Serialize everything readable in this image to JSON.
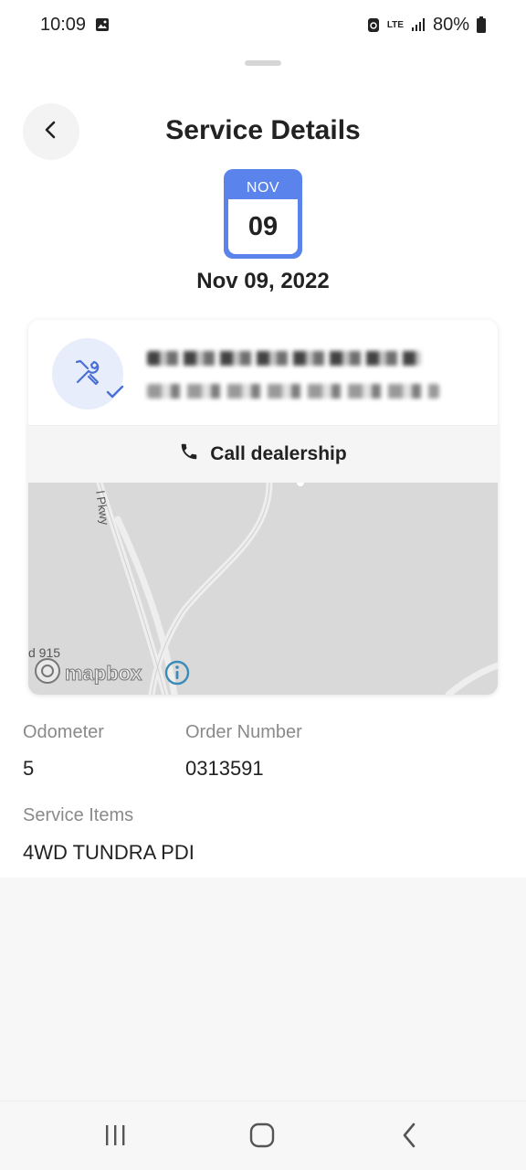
{
  "status_bar": {
    "time": "10:09",
    "network": "LTE",
    "battery": "80%"
  },
  "header": {
    "title": "Service Details"
  },
  "calendar": {
    "month": "NOV",
    "day": "09"
  },
  "service_date": "Nov 09, 2022",
  "dealer_card": {
    "call_label": "Call dealership",
    "map": {
      "road_label": "l Pkwy",
      "route_label": "d 915",
      "attribution": "mapbox"
    }
  },
  "details": {
    "odometer_label": "Odometer",
    "odometer_value": "5",
    "order_number_label": "Order Number",
    "order_number_value": "0313591",
    "service_items_label": "Service Items",
    "service_items_value": "4WD TUNDRA PDI"
  },
  "colors": {
    "accent": "#5a83ec",
    "avatar_bg": "#e8edfb",
    "map_bg": "#d9d9d9"
  }
}
